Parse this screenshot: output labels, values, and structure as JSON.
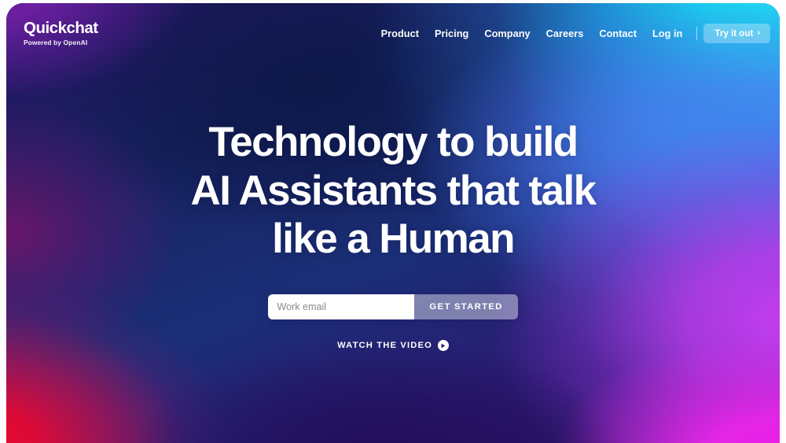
{
  "brand": {
    "name": "Quickchat",
    "tagline_prefix": "Powered by ",
    "tagline_strong": "OpenAI"
  },
  "nav": {
    "links": [
      {
        "label": "Product"
      },
      {
        "label": "Pricing"
      },
      {
        "label": "Company"
      },
      {
        "label": "Careers"
      },
      {
        "label": "Contact"
      },
      {
        "label": "Log in"
      }
    ],
    "cta": {
      "label": "Try it out",
      "chevron": "›"
    }
  },
  "hero": {
    "headline_line1": "Technology to build",
    "headline_line2": "AI Assistants that talk",
    "headline_line3": "like a Human",
    "email_placeholder": "Work email",
    "email_value": "",
    "submit_label": "GET STARTED",
    "watch_video_label": "WATCH THE VIDEO",
    "play_icon": "play-circle-icon"
  },
  "colors": {
    "cyan": "#19e6f5",
    "blue": "#3f86ef",
    "navy": "#1b2a6b",
    "purple": "#7a1ca6",
    "violet": "#c43df0",
    "magenta": "#ee1ce8",
    "crimson": "#ec0b2e",
    "deep_indigo": "#2a1060",
    "text_on_hero": "#ffffff",
    "input_text": "#333333",
    "placeholder": "#8a8a8a"
  }
}
